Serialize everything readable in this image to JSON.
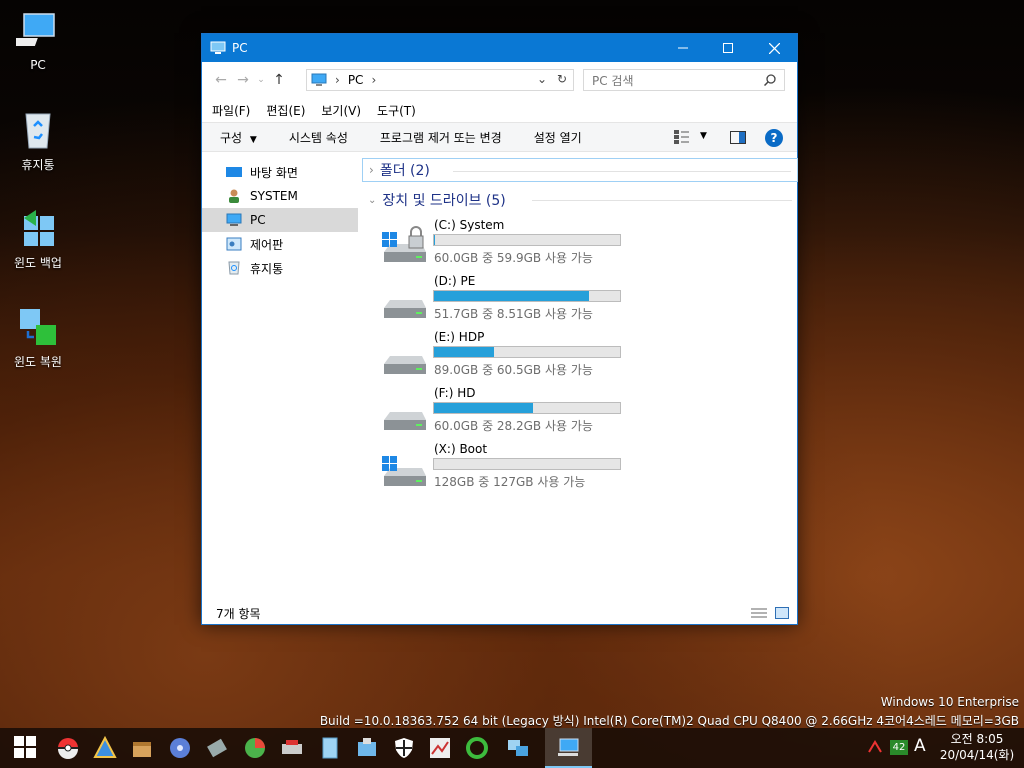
{
  "desktop": {
    "icons": [
      {
        "label": "PC"
      },
      {
        "label": "휴지통"
      },
      {
        "label": "윈도 백업"
      },
      {
        "label": "윈도 복원"
      }
    ],
    "watermark_line1": "Windows 10 Enterprise",
    "watermark_line2": "Build =10.0.18363.752 64 bit (Legacy 방식)   Intel(R) Core(TM)2 Quad CPU    Q8400  @ 2.66GHz 4코어4스레드 메모리=3GB"
  },
  "window": {
    "title": "PC",
    "address": {
      "path": "PC",
      "separator": "›"
    },
    "search": {
      "placeholder": "PC 검색"
    },
    "menu": [
      "파일(F)",
      "편집(E)",
      "보기(V)",
      "도구(T)"
    ],
    "commands": [
      "구성",
      "시스템 속성",
      "프로그램 제거 또는 변경",
      "설정 열기"
    ],
    "nav": [
      {
        "label": "바탕 화면"
      },
      {
        "label": "SYSTEM"
      },
      {
        "label": "PC"
      },
      {
        "label": "제어판"
      },
      {
        "label": "휴지통"
      }
    ],
    "groups": {
      "folders": "폴더 (2)",
      "drives": "장치 및 드라이브 (5)"
    },
    "drives": [
      {
        "name": "(C:) System",
        "free": "60.0GB 중 59.9GB 사용 가능",
        "used_fraction": 0.002,
        "icon": "windows-drive-lock-icon"
      },
      {
        "name": "(D:) PE",
        "free": "51.7GB 중 8.51GB 사용 가능",
        "used_fraction": 0.835,
        "icon": "hard-drive-icon"
      },
      {
        "name": "(E:) HDP",
        "free": "89.0GB 중 60.5GB 사용 가능",
        "used_fraction": 0.32,
        "icon": "hard-drive-icon"
      },
      {
        "name": "(F:) HD",
        "free": "60.0GB 중 28.2GB 사용 가능",
        "used_fraction": 0.53,
        "icon": "hard-drive-icon"
      },
      {
        "name": "(X:) Boot",
        "free": "128GB 중 127GB 사용 가능",
        "used_fraction": 0.0,
        "icon": "windows-drive-icon"
      }
    ],
    "status": "7개 항목"
  },
  "taskbar": {
    "tray_badge": "42",
    "ime": "A",
    "time": "오전 8:05",
    "date": "20/04/14(화)"
  },
  "colors": {
    "accent": "#0a78d4",
    "progress": "#26a0da",
    "group_heading": "#1e3287"
  }
}
